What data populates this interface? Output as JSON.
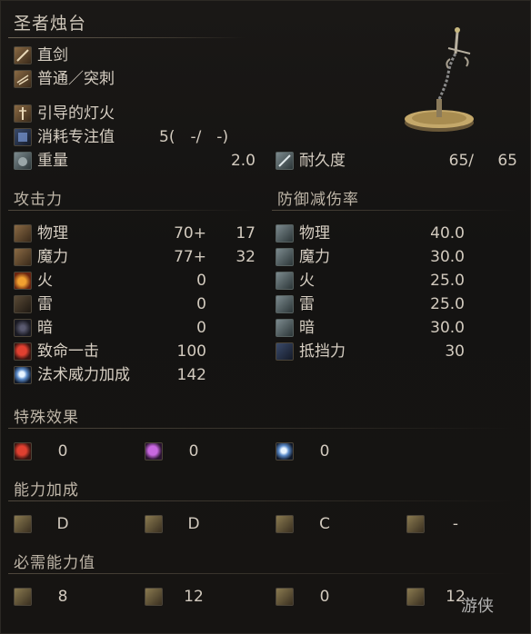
{
  "weapon": {
    "name": "圣者烛台",
    "type": "直剑",
    "attack_type": "普通／突刺",
    "skill": "引导的灯火",
    "fp_cost_label": "消耗专注值",
    "fp_cost_value": "5(　-/　-)",
    "weight_label": "重量",
    "weight_value": "2.0",
    "durability_label": "耐久度",
    "durability_current": "65/",
    "durability_max": "65"
  },
  "attack": {
    "title": "攻击力",
    "rows": [
      {
        "label": "物理",
        "base": "70+",
        "bonus": "17",
        "icon": "physical-icon"
      },
      {
        "label": "魔力",
        "base": "77+",
        "bonus": "32",
        "icon": "magic-icon"
      },
      {
        "label": "火",
        "base": "0",
        "bonus": "",
        "icon": "fire-icon"
      },
      {
        "label": "雷",
        "base": "0",
        "bonus": "",
        "icon": "lightning-icon"
      },
      {
        "label": "暗",
        "base": "0",
        "bonus": "",
        "icon": "dark-icon"
      },
      {
        "label": "致命一击",
        "base": "100",
        "bonus": "",
        "icon": "critical-icon"
      },
      {
        "label": "法术威力加成",
        "base": "142",
        "bonus": "",
        "icon": "spell-buff-icon"
      }
    ]
  },
  "defense": {
    "title": "防御减伤率",
    "rows": [
      {
        "label": "物理",
        "value": "40.0",
        "icon": "physical-defense-icon"
      },
      {
        "label": "魔力",
        "value": "30.0",
        "icon": "magic-defense-icon"
      },
      {
        "label": "火",
        "value": "25.0",
        "icon": "fire-defense-icon"
      },
      {
        "label": "雷",
        "value": "25.0",
        "icon": "lightning-defense-icon"
      },
      {
        "label": "暗",
        "value": "30.0",
        "icon": "dark-defense-icon"
      },
      {
        "label": "抵挡力",
        "value": "30",
        "icon": "stability-icon"
      }
    ]
  },
  "effects": {
    "title": "特殊效果",
    "items": [
      {
        "value": "0",
        "icon": "bleed-icon"
      },
      {
        "value": "0",
        "icon": "poison-icon"
      },
      {
        "value": "0",
        "icon": "frost-icon"
      }
    ]
  },
  "scaling": {
    "title": "能力加成",
    "items": [
      {
        "value": "D",
        "icon": "strength-icon"
      },
      {
        "value": "D",
        "icon": "dexterity-icon"
      },
      {
        "value": "C",
        "icon": "intelligence-icon"
      },
      {
        "value": "-",
        "icon": "faith-icon"
      }
    ]
  },
  "requirements": {
    "title": "必需能力值",
    "items": [
      {
        "value": "8",
        "icon": "strength-icon"
      },
      {
        "value": "12",
        "icon": "dexterity-icon"
      },
      {
        "value": "0",
        "icon": "intelligence-icon"
      },
      {
        "value": "12",
        "icon": "faith-icon"
      }
    ]
  },
  "watermark": "游侠"
}
